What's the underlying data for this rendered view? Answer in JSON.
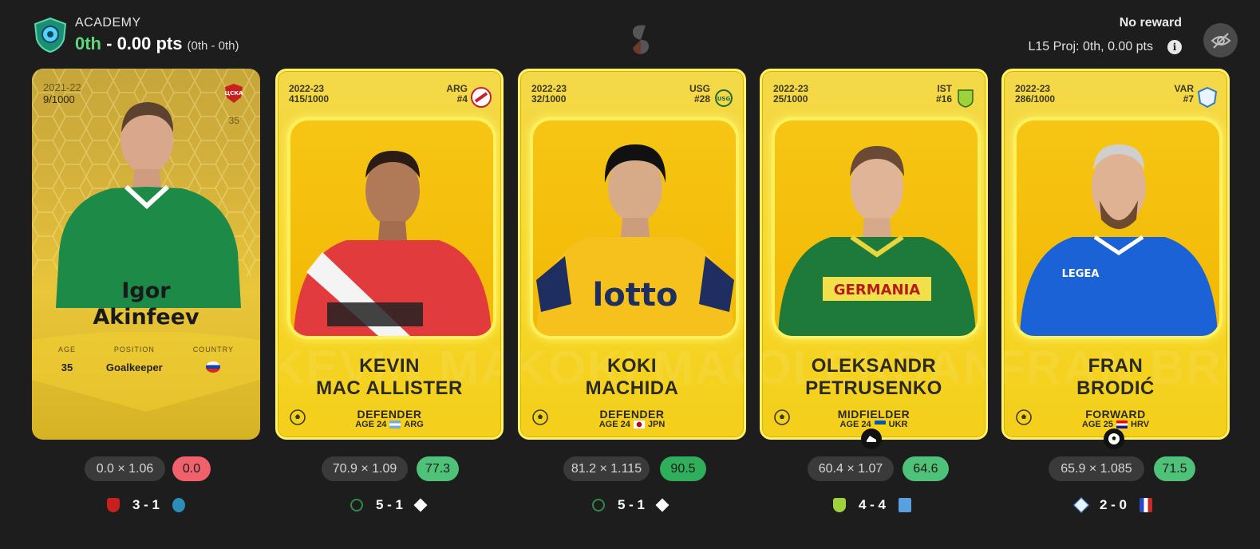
{
  "header": {
    "league": "ACADEMY",
    "rank": "0th",
    "separator": " - ",
    "points": "0.00 pts",
    "range": "(0th - 0th)",
    "reward": "No reward",
    "projection": "L15 Proj: 0th, 0.00 pts"
  },
  "icons": {
    "logo": "academy-shield-icon",
    "center": "sorare-logo-icon",
    "info": "info-icon",
    "eye": "eye-off-icon"
  },
  "cards": [
    {
      "style": "legacy",
      "season": "2021-22",
      "serial": "9/1000",
      "shirt_number": "35",
      "first_name": "Igor",
      "last_name": "Akinfeev",
      "labels": {
        "age": "AGE",
        "position": "POSITION",
        "country": "COUNTRY"
      },
      "age": "35",
      "position": "Goalkeeper",
      "country_flag": "russia-flag"
    },
    {
      "style": "rare",
      "season": "2022-23",
      "serial": "415/1000",
      "team": "ARG",
      "number": "#4",
      "first_name": "KEVIN",
      "last_name": "MAC ALLISTER",
      "position": "DEFENDER",
      "age": "AGE 24",
      "country": "ARG",
      "ghost": "KEVIN MAC"
    },
    {
      "style": "rare",
      "season": "2022-23",
      "serial": "32/1000",
      "team": "USG",
      "number": "#28",
      "first_name": "KOKI",
      "last_name": "MACHIDA",
      "position": "DEFENDER",
      "age": "AGE 24",
      "country": "JPN",
      "ghost": "KOKI MACHID"
    },
    {
      "style": "rare",
      "season": "2022-23",
      "serial": "25/1000",
      "team": "IST",
      "number": "#16",
      "first_name": "OLEKSANDR",
      "last_name": "PETRUSENKO",
      "position": "MIDFIELDER",
      "age": "AGE 24",
      "country": "UKR",
      "ghost": "OLEKSANDR"
    },
    {
      "style": "rare",
      "season": "2022-23",
      "serial": "286/1000",
      "team": "VAR",
      "number": "#7",
      "first_name": "FRAN",
      "last_name": "BRODIĆ",
      "position": "FORWARD",
      "age": "AGE 25",
      "country": "HRV",
      "ghost": "FRAN BRODIĆ"
    }
  ],
  "scores": [
    {
      "multiplier": "0.0 × 1.06",
      "total": "0.0",
      "total_color": "#f0616b",
      "match": "3 - 1"
    },
    {
      "multiplier": "70.9 × 1.09",
      "total": "77.3",
      "total_color": "#4fc27a",
      "match": "5 - 1"
    },
    {
      "multiplier": "81.2 × 1.115",
      "total": "90.5",
      "total_color": "#2fae5c",
      "match": "5 - 1"
    },
    {
      "multiplier": "60.4 × 1.07",
      "total": "64.6",
      "total_color": "#4fc27a",
      "match": "4 - 4"
    },
    {
      "multiplier": "65.9 × 1.085",
      "total": "71.5",
      "total_color": "#4fc27a",
      "match": "2 - 0"
    }
  ]
}
